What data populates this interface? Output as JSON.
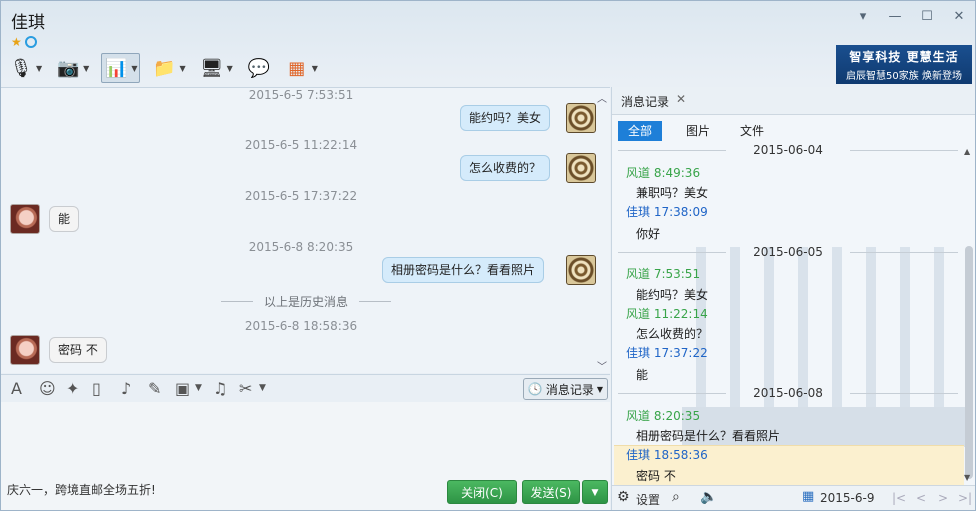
{
  "window": {
    "contact_name": "佳琪",
    "controls": [
      "▾",
      "—",
      "☐",
      "✕"
    ]
  },
  "toolbar": {
    "items": [
      {
        "name": "mic-icon",
        "glyph": "🎙",
        "dropdown": true
      },
      {
        "name": "webcam-icon",
        "glyph": "📷",
        "dropdown": true
      },
      {
        "name": "screen-share-icon",
        "glyph": "📊",
        "dropdown": true,
        "active": true
      },
      {
        "name": "send-file-icon",
        "glyph": "📁",
        "dropdown": true
      },
      {
        "name": "remote-desktop-icon",
        "glyph": "🖥",
        "dropdown": true
      },
      {
        "name": "add-chat-icon",
        "glyph": "💬",
        "dropdown": false
      },
      {
        "name": "apps-icon",
        "glyph": "▦",
        "dropdown": true
      }
    ]
  },
  "banner": {
    "line1": "智享科技 更慧生活",
    "line2": "启辰智慧50家族 焕新登场"
  },
  "chat": {
    "ts1": "2015-6-5 7:53:51",
    "m1": "能约吗？美女",
    "ts2": "2015-6-5 11:22:14",
    "m2": "怎么收费的？",
    "ts3": "2015-6-5 17:37:22",
    "m3": "能",
    "ts4": "2015-6-8 8:20:35",
    "m4": "相册密码是什么？看看照片",
    "history_divider": "以上是历史消息",
    "ts5": "2015-6-8 18:58:36",
    "m5": "密码 不"
  },
  "format_bar": {
    "history_button": "消息记录"
  },
  "compose": {
    "promo": "庆六一，跨境直邮全场五折!",
    "close_label": "关闭(C)",
    "send_label": "发送(S)"
  },
  "history": {
    "tab_label": "消息记录",
    "filters": [
      "全部",
      "图片",
      "文件"
    ],
    "d1": "2015-06-04",
    "s1": "风道 8:49:36",
    "t1": "兼职吗？美女",
    "s2": "佳琪 17:38:09",
    "t2": "你好",
    "d2": "2015-06-05",
    "s3": "风道 7:53:51",
    "t3": "能约吗？美女",
    "s4": "风道 11:22:14",
    "t4": "怎么收费的？",
    "s5": "佳琪 17:37:22",
    "t5": "能",
    "d3": "2015-06-08",
    "s6": "风道 8:20:35",
    "t6": "相册密码是什么？看看照片",
    "s7": "佳琪 18:58:36",
    "t7": "密码 不",
    "footer_settings": "设置",
    "footer_date": "2015-6-9"
  },
  "colors": {
    "accent": "#1e7fd8",
    "send_button": "#3aa653",
    "sender_fengdao": "#38a449",
    "sender_jiaqi": "#2065c7"
  }
}
